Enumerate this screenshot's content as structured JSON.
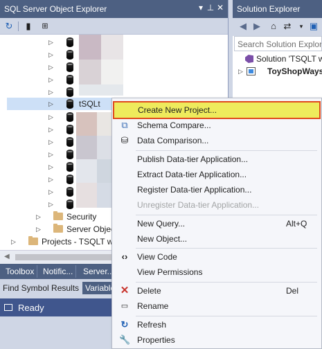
{
  "left_pane": {
    "title": "SQL Server Object Explorer",
    "title_buttons": [
      "▾",
      "ᵖ",
      "✕"
    ],
    "toolbar": {
      "refresh_icon": "refresh-icon",
      "add_icon": "add-server-icon",
      "filter_icon": "filter-icon"
    },
    "tree": {
      "selected_label": "tSQLt",
      "security_label": "Security",
      "server_objects_label": "Server Objec",
      "projects_label": "Projects - TSQLT wi"
    },
    "tabs": [
      "Toolbox",
      "Notific...",
      "Server..."
    ]
  },
  "bottom": {
    "find_symbol": "Find Symbol Results",
    "variables": "Variable"
  },
  "status": {
    "ready": "Ready"
  },
  "right_pane": {
    "title": "Solution Explorer",
    "search_placeholder": "Search Solution Explore",
    "solution_label": "Solution 'TSQLT wi",
    "project_label": "ToyShopWays"
  },
  "context_menu": {
    "items": [
      {
        "label": "Create New Project...",
        "shortcut": "",
        "icon": "",
        "disabled": false,
        "highlight": true
      },
      {
        "label": "Schema Compare...",
        "shortcut": "",
        "icon": "schema-compare-icon",
        "disabled": false
      },
      {
        "label": "Data Comparison...",
        "shortcut": "",
        "icon": "data-compare-icon",
        "disabled": false
      },
      {
        "label": "Publish Data-tier Application...",
        "shortcut": "",
        "icon": "",
        "disabled": false
      },
      {
        "label": "Extract Data-tier Application...",
        "shortcut": "",
        "icon": "",
        "disabled": false
      },
      {
        "label": "Register Data-tier Application...",
        "shortcut": "",
        "icon": "",
        "disabled": false
      },
      {
        "label": "Unregister Data-tier Application...",
        "shortcut": "",
        "icon": "",
        "disabled": true
      },
      {
        "label": "New Query...",
        "shortcut": "Alt+Q",
        "icon": "",
        "disabled": false
      },
      {
        "label": "New Object...",
        "shortcut": "",
        "icon": "",
        "disabled": false
      },
      {
        "label": "View Code",
        "shortcut": "",
        "icon": "view-code-icon",
        "disabled": false
      },
      {
        "label": "View Permissions",
        "shortcut": "",
        "icon": "",
        "disabled": false
      },
      {
        "label": "Delete",
        "shortcut": "Del",
        "icon": "delete-icon",
        "disabled": false
      },
      {
        "label": "Rename",
        "shortcut": "",
        "icon": "rename-icon",
        "disabled": false
      },
      {
        "label": "Refresh",
        "shortcut": "",
        "icon": "refresh-icon",
        "disabled": false
      },
      {
        "label": "Properties",
        "shortcut": "",
        "icon": "properties-icon",
        "disabled": false
      }
    ]
  },
  "colors": {
    "title_bar": "#4d6082",
    "status_bar": "#40568d",
    "highlight": "#eeeb5c",
    "highlight_border": "#e0491d"
  }
}
